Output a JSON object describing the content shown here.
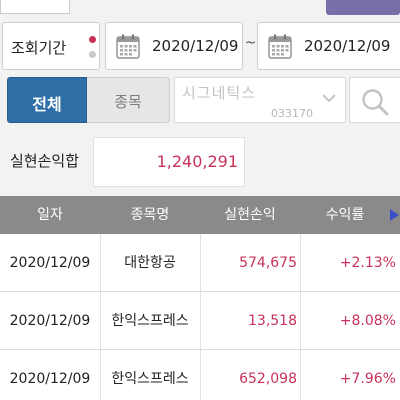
{
  "period": {
    "label": "조회기간",
    "from_date": "2020/12/09",
    "separator": "~",
    "to_date": "2020/12/09"
  },
  "tabs": [
    {
      "label": "전체",
      "selected": true
    },
    {
      "label": "종목",
      "selected": false
    }
  ],
  "stock_selector": {
    "name": "시그네틱스",
    "code": "033170"
  },
  "summary": {
    "label": "실현손익합",
    "value": "1,240,291"
  },
  "table": {
    "headers": [
      "일자",
      "종목명",
      "실현손익",
      "수익률"
    ],
    "rows": [
      {
        "date": "2020/12/09",
        "name": "대한항공",
        "profit": "574,675",
        "rate": "+2.13%"
      },
      {
        "date": "2020/12/09",
        "name": "한익스프레스",
        "profit": "13,518",
        "rate": "+8.08%"
      },
      {
        "date": "2020/12/09",
        "name": "한익스프레스",
        "profit": "652,098",
        "rate": "+7.96%"
      }
    ]
  },
  "colors": {
    "accent": "#2e6fa8",
    "positive": "#c8325a",
    "header_bg": "#8a8a8a"
  },
  "icons": [
    "calendar-icon",
    "chevron-down-icon",
    "search-icon",
    "scroll-right-arrow-icon"
  ]
}
